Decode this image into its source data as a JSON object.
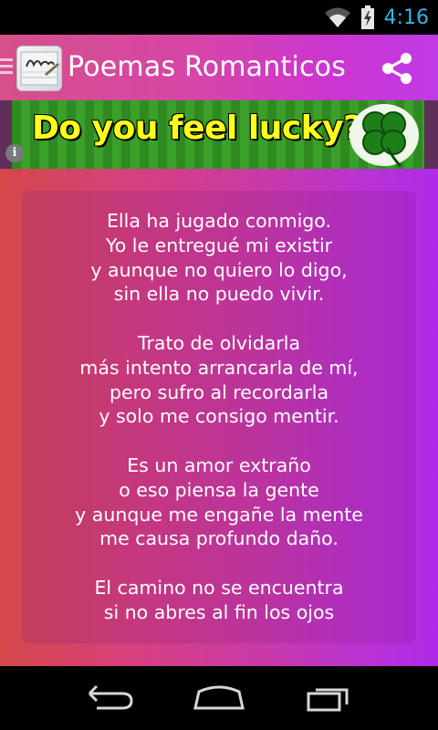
{
  "status_bar": {
    "time": "4:16"
  },
  "app_bar": {
    "title": "Poemas Romanticos",
    "logo_icon": "love-note-icon",
    "share_icon": "share-icon"
  },
  "ad": {
    "text": "Do you feel lucky?",
    "info_icon": "i",
    "image_icon": "four-leaf-clover"
  },
  "poem": {
    "stanzas": [
      [
        "Ella ha jugado conmigo.",
        "Yo le entregué mi existir",
        "y aunque no quiero lo digo,",
        "sin ella no puedo vivir."
      ],
      [
        "Trato de olvidarla",
        "más intento arrancarla de mí,",
        "pero sufro al recordarla",
        "y solo me consigo mentir."
      ],
      [
        "Es un amor extraño",
        "o eso piensa la gente",
        "y aunque me engañe la mente",
        "me causa profundo daño."
      ],
      [
        "El camino no se encuentra",
        "si no abres al fin los ojos"
      ]
    ]
  },
  "nav_bar": {
    "back_icon": "back-icon",
    "home_icon": "home-icon",
    "recents_icon": "recents-icon"
  },
  "colors": {
    "clock": "#33b5e5",
    "ad_text": "#ffff1a",
    "ad_green": "#2f8a22"
  }
}
